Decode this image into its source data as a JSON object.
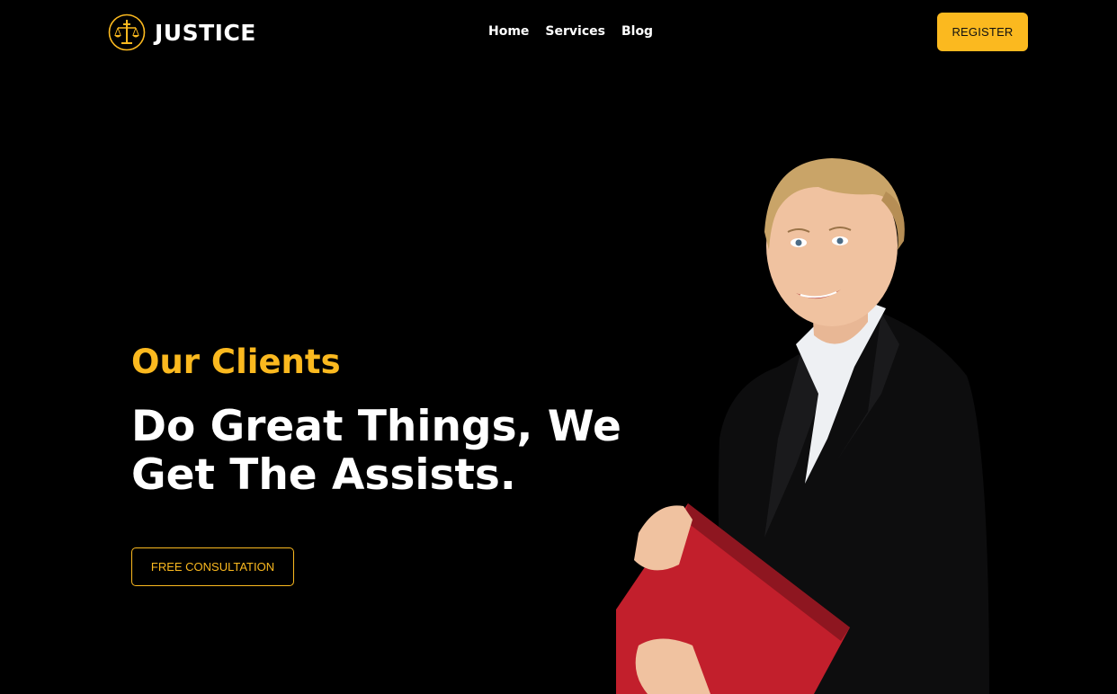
{
  "brand": {
    "name": "JUSTICE",
    "logo_icon": "scales-sword-icon",
    "accent": "#fbb91f"
  },
  "nav": {
    "items": [
      {
        "label": "Home"
      },
      {
        "label": "Services"
      },
      {
        "label": "Blog"
      }
    ]
  },
  "header": {
    "register_label": "REGISTER"
  },
  "hero": {
    "eyebrow": "Our Clients",
    "headline_line1": "Do Great Things, We",
    "headline_line2": "Get The Assists.",
    "cta_label": "FREE CONSULTATION",
    "image": "businesswoman-holding-red-folder"
  },
  "colors": {
    "background": "#000000",
    "accent": "#fbb91f",
    "text": "#ffffff"
  }
}
